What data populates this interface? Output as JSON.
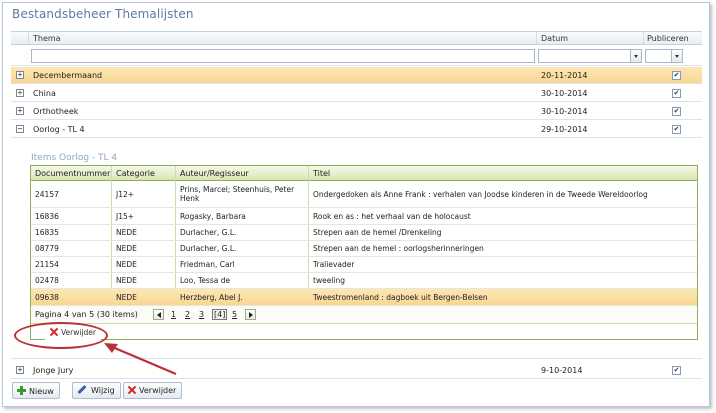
{
  "page_title": "Bestandsbeheer Themalijsten",
  "columns": {
    "thema": "Thema",
    "datum": "Datum",
    "publiceren": "Publiceren"
  },
  "icons": {
    "expand": "plus-square-icon",
    "collapse": "minus-square-icon",
    "checkbox": "checkmark-icon",
    "dropdown": "chevron-down-icon",
    "delete": "red-x-icon",
    "add": "green-plus-icon",
    "edit": "pencil-icon",
    "prev": "arrow-left-icon",
    "next": "arrow-right-icon"
  },
  "colors": {
    "title": "#5c7ba3",
    "selected_row": "#f9d792",
    "subgrid_border": "#8fae5a",
    "annotation": "#b83236"
  },
  "rows": [
    {
      "thema": "Decembermaand",
      "datum": "20-11-2014",
      "publiceren": true,
      "toggle": "+"
    },
    {
      "thema": "China",
      "datum": "30-10-2014",
      "publiceren": true,
      "toggle": "+"
    },
    {
      "thema": "Orthotheek",
      "datum": "30-10-2014",
      "publiceren": true,
      "toggle": "+"
    },
    {
      "thema": "Oorlog - TL 4",
      "datum": "29-10-2014",
      "publiceren": true,
      "toggle": "−"
    }
  ],
  "detail": {
    "title": "Items Oorlog - TL 4",
    "columns": {
      "doc": "Documentnummer",
      "cat": "Categorie",
      "auteur": "Auteur/Regisseur",
      "titel": "Titel"
    },
    "items": [
      {
        "doc": "24157",
        "cat": "J12+",
        "auteur": "Prins, Marcel; Steenhuis, Peter Henk",
        "titel": "Ondergedoken als Anne Frank : verhalen van Joodse kinderen in de Tweede Wereldoorlog"
      },
      {
        "doc": "16836",
        "cat": "J15+",
        "auteur": "Rogasky, Barbara",
        "titel": "Rook en as : het verhaal van de holocaust"
      },
      {
        "doc": "16835",
        "cat": "NEDE",
        "auteur": "Durlacher, G.L.",
        "titel": "Strepen aan de hemel /Drenkeling"
      },
      {
        "doc": "08779",
        "cat": "NEDE",
        "auteur": "Durlacher, G.L.",
        "titel": "Strepen aan de hemel : oorlogsherinneringen"
      },
      {
        "doc": "21154",
        "cat": "NEDE",
        "auteur": "Friedman, Carl",
        "titel": "Tralievader"
      },
      {
        "doc": "02478",
        "cat": "NEDE",
        "auteur": "Loo, Tessa de",
        "titel": "tweeling"
      },
      {
        "doc": "09638",
        "cat": "NEDE",
        "auteur": "Herzberg, Abel J.",
        "titel": "Tweestromenland : dagboek uit Bergen-Belsen"
      }
    ],
    "pager": {
      "label": "Pagina 4 van 5 (30 items)",
      "pages": [
        "1",
        "2",
        "3",
        "[4]",
        "5"
      ],
      "current": "[4]"
    },
    "delete_label": "Verwijder"
  },
  "last_row": {
    "thema": "Jonge Jury",
    "datum": "9-10-2014",
    "publiceren": true,
    "toggle": "+"
  },
  "toolbar": {
    "new_label": "Nieuw",
    "edit_label": "Wijzig",
    "delete_label": "Verwijder"
  }
}
